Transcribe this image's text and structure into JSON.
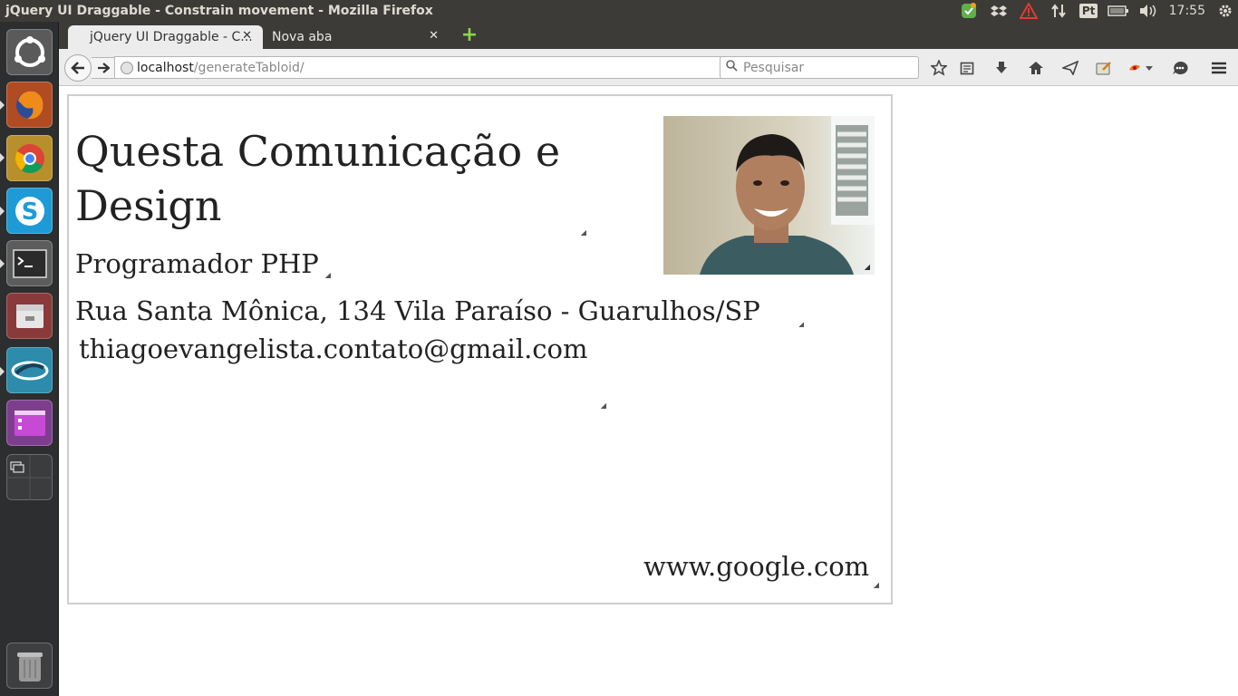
{
  "window": {
    "title": "jQuery UI Draggable - Constrain movement - Mozilla Firefox"
  },
  "tray": {
    "keyboard_layout": "Pt",
    "clock": "17:55"
  },
  "launcher": {
    "items": [
      "ubuntu-dash",
      "firefox",
      "chrome",
      "skype",
      "terminal",
      "files",
      "cloud-app",
      "purple-app",
      "workspace-switcher",
      "trash"
    ]
  },
  "tabs": [
    {
      "label": "jQuery UI Draggable - C...",
      "active": true
    },
    {
      "label": "Nova aba",
      "active": false
    }
  ],
  "navbar": {
    "url_host": "localhost",
    "url_path": "/generateTabloid/",
    "search_placeholder": "Pesquisar"
  },
  "tabloid": {
    "company_name": "Questa Comunicação e Design",
    "job_title": "Programador PHP",
    "address": "Rua Santa Mônica, 134 Vila Paraíso - Guarulhos/SP",
    "email": "thiagoevangelista.contato@gmail.com",
    "website": "www.google.com"
  },
  "colors": {
    "panel": "#3c3b37",
    "launcher": "#2c2e2f",
    "chrome": "#ececec",
    "accent_green": "#8bd642"
  }
}
